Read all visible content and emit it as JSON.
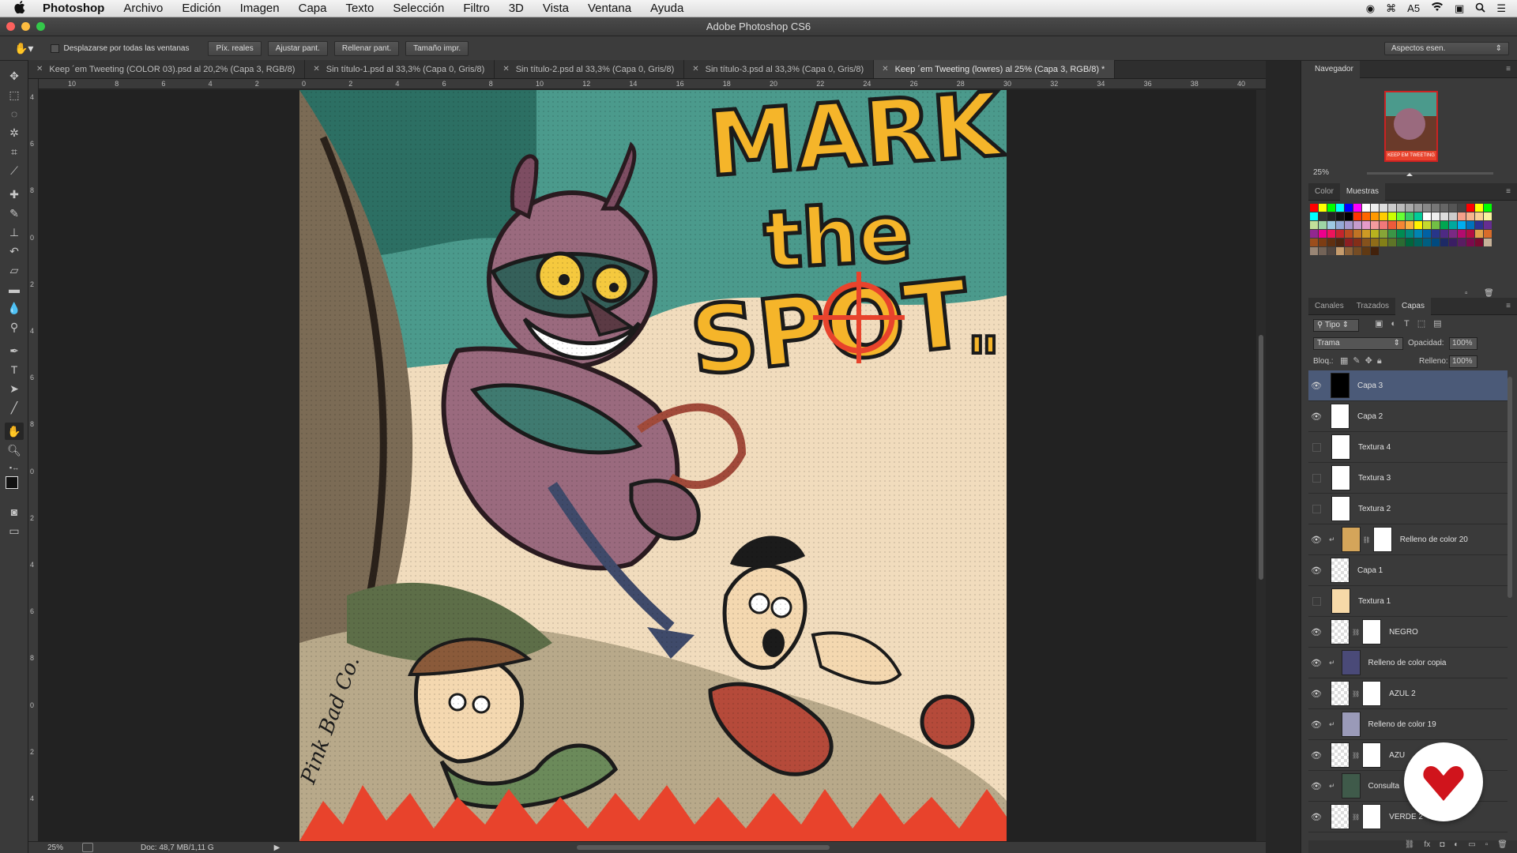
{
  "menubar": {
    "app": "Photoshop",
    "items": [
      "Archivo",
      "Edición",
      "Imagen",
      "Capa",
      "Texto",
      "Selección",
      "Filtro",
      "3D",
      "Vista",
      "Ventana",
      "Ayuda"
    ],
    "battery": "5"
  },
  "window": {
    "title": "Adobe Photoshop CS6"
  },
  "options": {
    "scroll_all_label": "Desplazarse por todas las ventanas",
    "buttons": [
      "Píx. reales",
      "Ajustar pant.",
      "Rellenar pant.",
      "Tamaño impr."
    ],
    "workspace": "Aspectos esen."
  },
  "tabs": [
    {
      "label": "Keep ´em Tweeting (COLOR 03).psd al 20,2% (Capa 3, RGB/8)"
    },
    {
      "label": "Sin título-1.psd al 33,3% (Capa 0, Gris/8)"
    },
    {
      "label": "Sin título-2.psd al 33,3% (Capa 0, Gris/8)"
    },
    {
      "label": "Sin título-3.psd al 33,3% (Capa 0, Gris/8)"
    },
    {
      "label": "Keep ´em Tweeting (lowres) al 25% (Capa 3, RGB/8) *"
    }
  ],
  "ruler": {
    "h": [
      "10",
      "8",
      "6",
      "4",
      "2",
      "0",
      "2",
      "4",
      "6",
      "8",
      "10",
      "12",
      "14",
      "16",
      "18",
      "20",
      "22",
      "24",
      "26",
      "28",
      "30",
      "32",
      "34",
      "36",
      "38",
      "40"
    ],
    "v": [
      "4",
      "6",
      "8",
      "0",
      "2",
      "4",
      "6",
      "8",
      "0",
      "2",
      "4",
      "6",
      "8",
      "0",
      "2",
      "4"
    ]
  },
  "artwork": {
    "title_line1": "MARK",
    "title_line2": "the",
    "title_line3": "SPOT",
    "quote": "\"",
    "signature": "Pink Bad Co."
  },
  "status": {
    "zoom": "25%",
    "doc": "Doc: 48,7 MB/1,11 G"
  },
  "navigator": {
    "title": "Navegador",
    "zoom": "25%",
    "thumb_caption": "KEEP EM TWEETING"
  },
  "color_panel": {
    "tabs": [
      "Color",
      "Muestras"
    ]
  },
  "swatches": [
    "#ff0000",
    "#ffff00",
    "#00ff00",
    "#00ffff",
    "#0000ff",
    "#ff00ff",
    "#ffffff",
    "#eeeeee",
    "#dddddd",
    "#cccccc",
    "#bbbbbb",
    "#aaaaaa",
    "#999999",
    "#888888",
    "#777777",
    "#666666",
    "#555555",
    "#444444",
    "#ff0000",
    "#ffff00",
    "#00ff00",
    "#00ffff",
    "#333333",
    "#222222",
    "#111111",
    "#000000",
    "#ff3300",
    "#ff6600",
    "#ff9900",
    "#ffcc00",
    "#ccff00",
    "#66ff33",
    "#33cc66",
    "#00cc99",
    "#ffffff",
    "#eeeeee",
    "#dddddd",
    "#cccccc",
    "#f4a08a",
    "#f6b48e",
    "#f9cf95",
    "#f7f19d",
    "#c2e09a",
    "#9ed5a5",
    "#9ec9e3",
    "#95a9d6",
    "#a799ce",
    "#c59ccd",
    "#e59ac9",
    "#f39b9e",
    "#f0787a",
    "#ee5a3a",
    "#f58634",
    "#fbb040",
    "#fff200",
    "#c6d92d",
    "#72bf44",
    "#00a651",
    "#00a99d",
    "#00aeef",
    "#0072bc",
    "#2e3192",
    "#662d91",
    "#92278f",
    "#ec008c",
    "#ed145b",
    "#c4252c",
    "#ba4a1f",
    "#c07324",
    "#cd9a24",
    "#b8b31e",
    "#86a537",
    "#3b9546",
    "#008b52",
    "#00897e",
    "#0085b2",
    "#0061a4",
    "#27368a",
    "#4e2a84",
    "#7a2984",
    "#b30b6e",
    "#b40e43",
    "#e1a24b",
    "#d86c2a",
    "#9c4e1c",
    "#7c3c13",
    "#603011",
    "#4d2610",
    "#8c1f22",
    "#842e18",
    "#86521c",
    "#8f6c18",
    "#838017",
    "#5e7427",
    "#2b6b32",
    "#00663c",
    "#00645c",
    "#005e80",
    "#004a7f",
    "#1d2a65",
    "#3a1e63",
    "#591d63",
    "#7b0a4d",
    "#7b0a2f",
    "#c7b299",
    "#998675",
    "#736357",
    "#534741",
    "#c69c6d",
    "#8c6239",
    "#754c24",
    "#603913",
    "#42210b"
  ],
  "layers_panel": {
    "tabs": [
      "Canales",
      "Trazados",
      "Capas"
    ],
    "filter": "Tipo",
    "blend_mode": "Trama",
    "opacity_label": "Opacidad:",
    "opacity": "100%",
    "lock_label": "Bloq.:",
    "fill_label": "Relleno:",
    "fill": "100%",
    "layers": [
      {
        "name": "Capa 3",
        "visible": true,
        "selected": true,
        "thumb": "#000000",
        "mask": false,
        "clip": false
      },
      {
        "name": "Capa 2",
        "visible": true,
        "selected": false,
        "thumb": "#ffffff",
        "mask": false,
        "clip": false
      },
      {
        "name": "Textura 4",
        "visible": false,
        "selected": false,
        "thumb": "#ffffff",
        "mask": false,
        "clip": false
      },
      {
        "name": "Textura 3",
        "visible": false,
        "selected": false,
        "thumb": "#ffffff",
        "mask": false,
        "clip": false
      },
      {
        "name": "Textura 2",
        "visible": false,
        "selected": false,
        "thumb": "#ffffff",
        "mask": false,
        "clip": false
      },
      {
        "name": "Relleno de color 20",
        "visible": true,
        "selected": false,
        "thumb": "#d4a55a",
        "mask": true,
        "clip": true
      },
      {
        "name": "Capa 1",
        "visible": true,
        "selected": false,
        "thumb": "checker",
        "mask": false,
        "clip": false
      },
      {
        "name": "Textura 1",
        "visible": false,
        "selected": false,
        "thumb": "#f7d9a8",
        "mask": false,
        "clip": false
      },
      {
        "name": "NEGRO",
        "visible": true,
        "selected": false,
        "thumb": "checker",
        "mask": true,
        "clip": false
      },
      {
        "name": "Relleno de color copia",
        "visible": true,
        "selected": false,
        "thumb": "#4a4a78",
        "mask": false,
        "clip": true
      },
      {
        "name": "AZUL 2",
        "visible": true,
        "selected": false,
        "thumb": "checker",
        "mask": true,
        "clip": false
      },
      {
        "name": "Relleno de color 19",
        "visible": true,
        "selected": false,
        "thumb": "#9a9ab8",
        "mask": false,
        "clip": true
      },
      {
        "name": "AZU",
        "visible": true,
        "selected": false,
        "thumb": "checker",
        "mask": true,
        "clip": false
      },
      {
        "name": "Consulta",
        "visible": true,
        "selected": false,
        "thumb": "#3f5a4a",
        "mask": false,
        "clip": true
      },
      {
        "name": "VERDE 2",
        "visible": true,
        "selected": false,
        "thumb": "checker",
        "mask": true,
        "clip": false
      }
    ]
  }
}
